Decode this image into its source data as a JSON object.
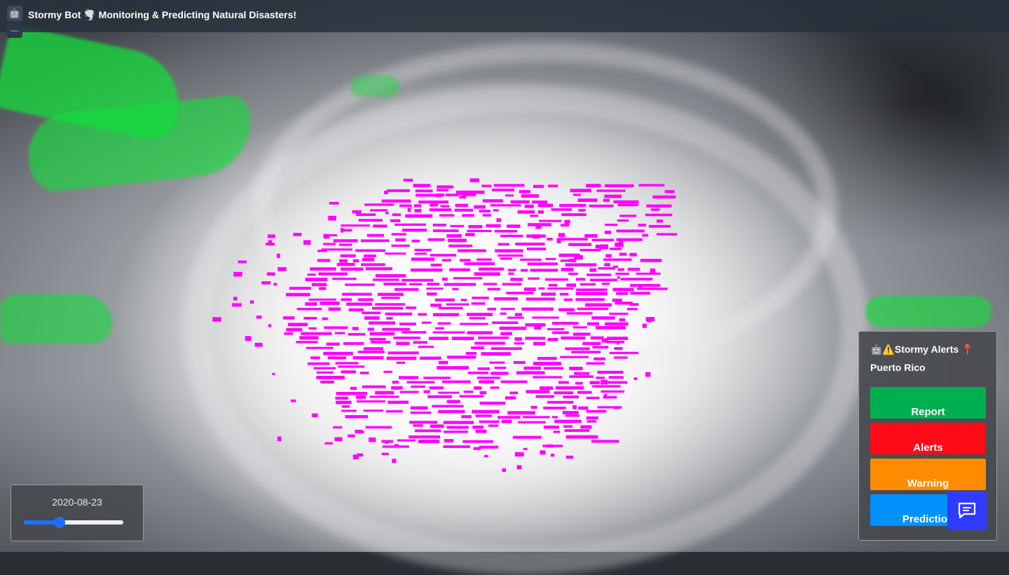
{
  "app": {
    "title": "Stormy Bot 🌪️ Monitoring & Predicting Natural Disasters!",
    "icon": "robot-icon"
  },
  "date_control": {
    "date": "2020-08-23",
    "slider_value_fraction": 0.36,
    "accent": "#1f6fff"
  },
  "alerts": {
    "title": "🤖⚠️Stormy Alerts 📍",
    "location": "Puerto Rico",
    "buttons": [
      {
        "label": "Report",
        "color": "#00b050"
      },
      {
        "label": "Alerts",
        "color": "#ff0a16"
      },
      {
        "label": "Warning",
        "color": "#ff8c00"
      },
      {
        "label": "Prediction",
        "color": "#0091ff"
      }
    ]
  },
  "chat": {
    "icon": "chat-icon",
    "color": "#2f3cff"
  },
  "map": {
    "rain_color": "#ff00ff",
    "land_color": "#14dc3c"
  }
}
